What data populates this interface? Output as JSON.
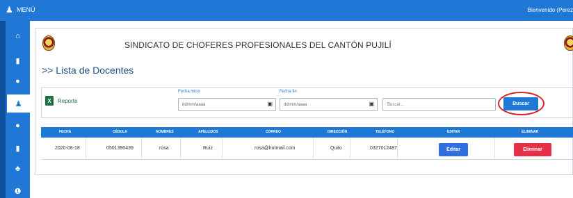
{
  "topbar": {
    "menu_label": "MENÚ",
    "welcome": "Bienvenido (Perez"
  },
  "org": {
    "title": "SINDICATO DE CHOFERES PROFESIONALES DEL CANTÓN PUJILÍ"
  },
  "page": {
    "title": ">> Lista de Docentes"
  },
  "filter": {
    "report_label": "Reporte",
    "fecha_inicio_label": "Fecha inicio",
    "fecha_fin_label": "Fecha fin",
    "date_placeholder": "dd/mm/aaaa",
    "search_placeholder": "Buscar...",
    "buscar_label": "Buscar"
  },
  "table": {
    "headers": [
      "FECHA",
      "CÉDULA",
      "NOMBRES",
      "APELLIDOS",
      "CORREO",
      "DIRECCIÓN",
      "TELÉFONO",
      "EDITAR",
      "ELIMINAR"
    ],
    "rows": [
      {
        "fecha": "2020-08-18",
        "cedula": "0501390439",
        "nombres": "rosa",
        "apellidos": "Ruiz",
        "correo": "rosa@hotmail.com",
        "direccion": "Quito",
        "telefono": "0327012487",
        "editar": "Editar",
        "eliminar": "Eliminar"
      }
    ]
  },
  "colors": {
    "primary": "#1f78d6",
    "danger": "#e53047",
    "edit": "#2f6fe0",
    "excel": "#1e7145",
    "highlight": "#d8202a"
  },
  "icons": {
    "menu": "user-tie-icon",
    "sidebar": [
      "home-icon",
      "file-icon",
      "user-icon",
      "user-tie-icon",
      "user-icon",
      "file-icon",
      "users-icon",
      "info-icon"
    ]
  }
}
